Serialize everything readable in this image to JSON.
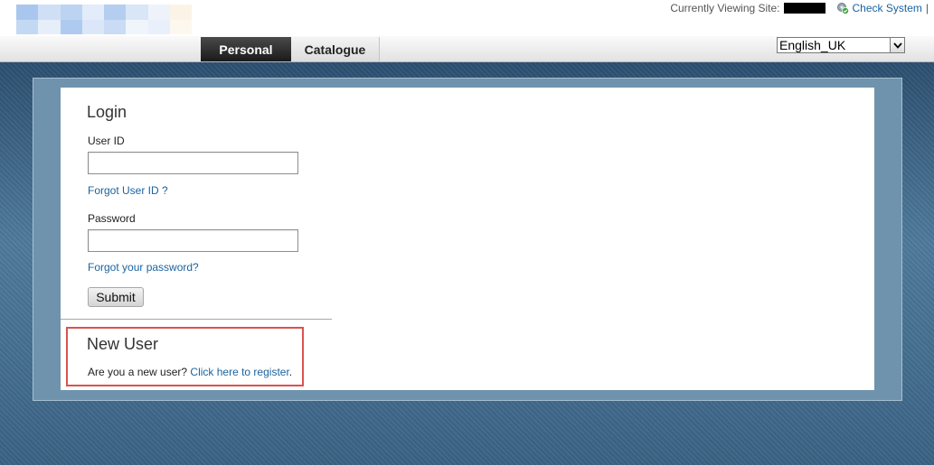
{
  "header": {
    "viewing_label": "Currently Viewing Site:",
    "check_system": "Check System",
    "separator": "|",
    "logo_colors": [
      "#a9c7ee",
      "#cfe0f6",
      "#bcd4f1",
      "#e2ecfa",
      "#b4cef0",
      "#d8e6f8",
      "#eef3fb",
      "#fbf4e6",
      "#c3d8f3",
      "#e6eefa",
      "#aecbef",
      "#dbe7f8",
      "#c9dbf5",
      "#f0f5fc",
      "#e9f0fb",
      "#fdf8ee"
    ]
  },
  "nav": {
    "tabs": [
      {
        "label": "Personal",
        "active": true
      },
      {
        "label": "Catalogue",
        "active": false
      }
    ],
    "language": "English_UK"
  },
  "login": {
    "title": "Login",
    "user_id_label": "User ID",
    "user_id_value": "",
    "forgot_user_id": "Forgot User ID ?",
    "password_label": "Password",
    "password_value": "",
    "forgot_password": "Forgot your password?",
    "submit": "Submit"
  },
  "new_user": {
    "title": "New User",
    "prompt": "Are you a new user?",
    "register_link": "Click here to register",
    "period": "."
  },
  "colors": {
    "link": "#1a63a0",
    "highlight_border": "#d9534f",
    "active_tab": "#1a1a1a"
  }
}
